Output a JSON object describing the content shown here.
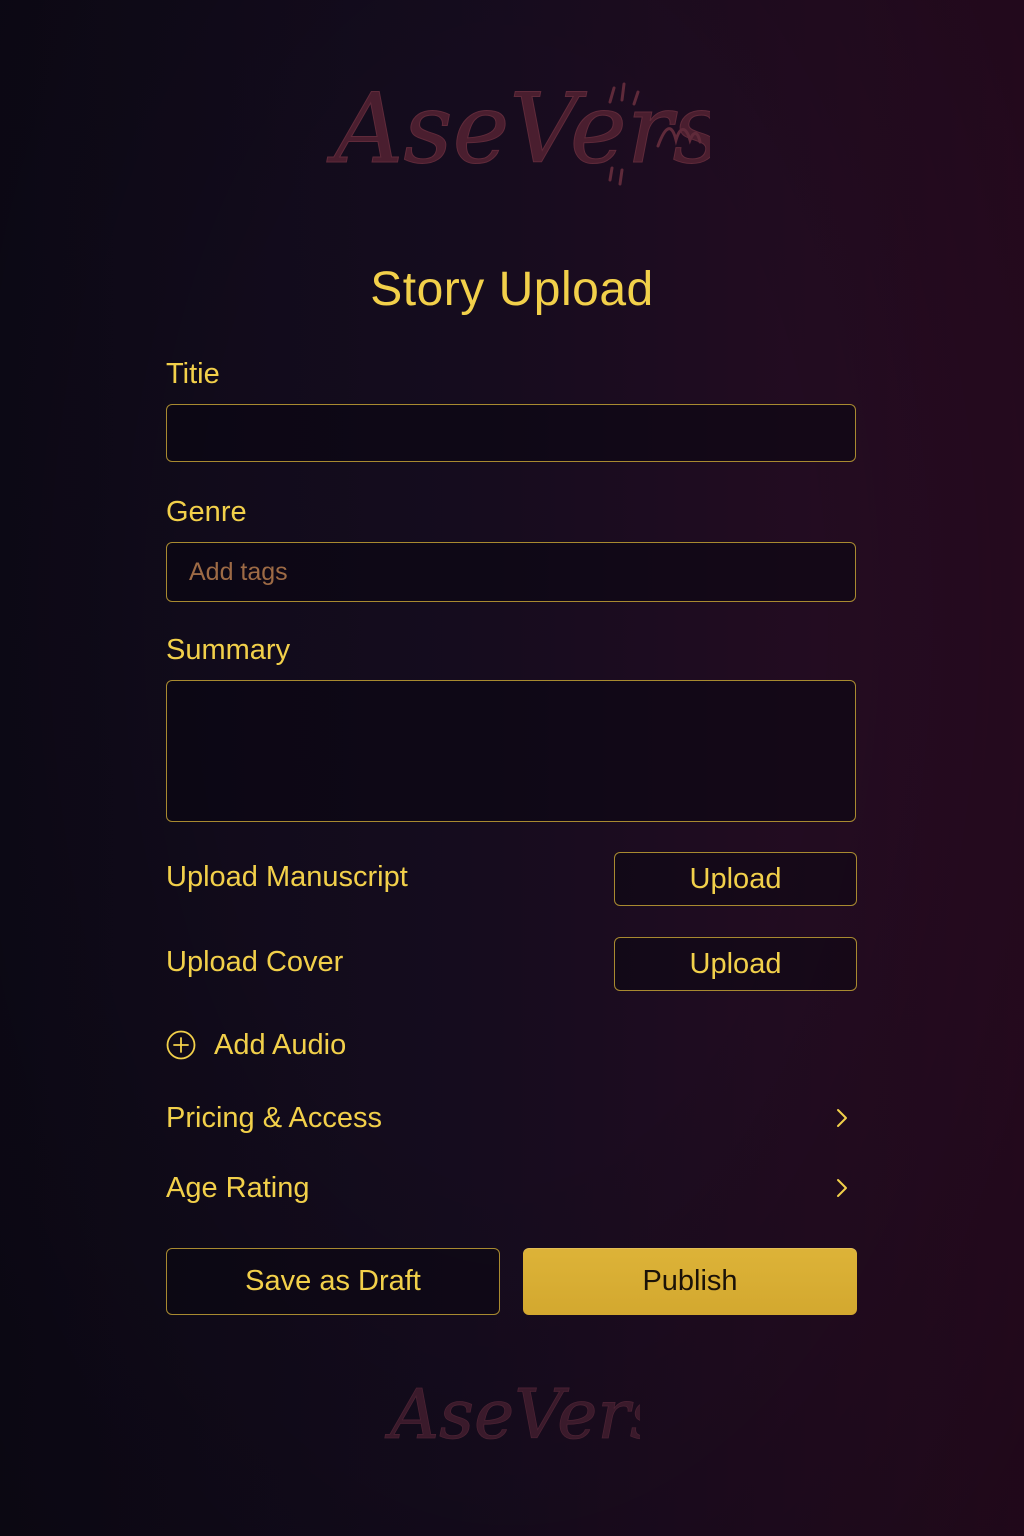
{
  "brand": {
    "logo_text": "AseVerse",
    "footer_logo_text": "AseVerse"
  },
  "page": {
    "title": "Story Upload"
  },
  "form": {
    "title_label": "Titie",
    "title_value": "",
    "genre_label": "Genre",
    "genre_placeholder": "Add tags",
    "summary_label": "Summary",
    "summary_value": "",
    "manuscript_label": "Upload Manuscript",
    "manuscript_button": "Upload",
    "cover_label": "Upload Cover",
    "cover_button": "Upload",
    "add_audio_label": "Add Audio",
    "pricing_label": "Pricing & Access",
    "age_rating_label": "Age Rating"
  },
  "actions": {
    "save_draft_label": "Save as Draft",
    "publish_label": "Publish"
  },
  "icons": {
    "add_audio": "plus-circle-icon",
    "pricing_chevron": "chevron-right-icon",
    "age_chevron": "chevron-right-icon"
  },
  "colors": {
    "accent_gold": "#f2d04a",
    "border_gold": "#a88a30",
    "publish_bg": "#d9ad33",
    "logo_maroon": "#5a2434",
    "background_start": "#0e0a18",
    "background_end": "#2a0b22",
    "placeholder": "#9d6a45"
  }
}
